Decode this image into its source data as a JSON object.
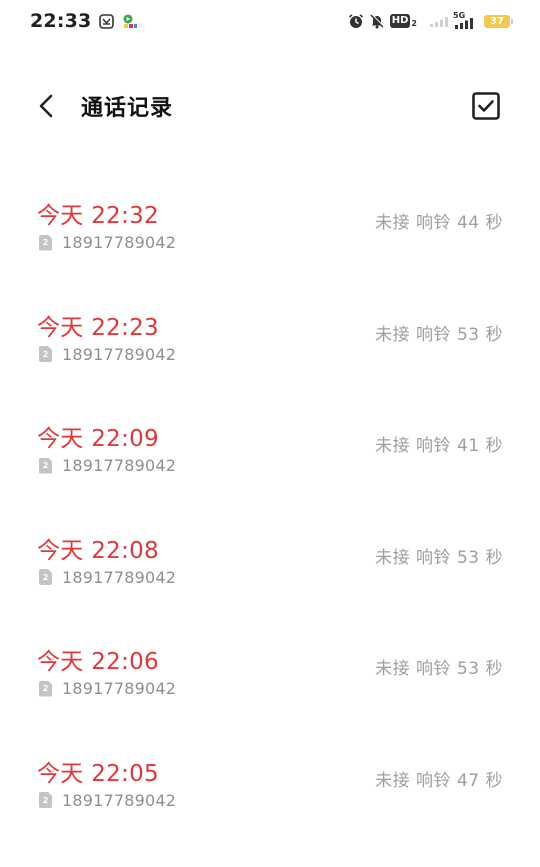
{
  "status_bar": {
    "time": "22:33",
    "icons": [
      "notification-app-icon",
      "game-app-icon",
      "alarm-icon",
      "mute-icon",
      "hd-icon",
      "signal-weak-icon",
      "signal-5g-icon"
    ],
    "network": "5G",
    "hd_label": "HD",
    "hd_sub": "2",
    "battery": "37",
    "battery_color": "#f2c94c"
  },
  "header": {
    "title": "通话记录",
    "back_icon": "chevron-left-icon",
    "select_icon": "checkbox-checked-icon"
  },
  "colors": {
    "missed": "#e0373d",
    "secondary": "#9e9e9e",
    "sim": "#c4c4c4"
  },
  "calls": [
    {
      "time": "今天 22:32",
      "sim": "2",
      "number": "18917789042",
      "status": "未接  响铃 44 秒"
    },
    {
      "time": "今天 22:23",
      "sim": "2",
      "number": "18917789042",
      "status": "未接  响铃 53 秒"
    },
    {
      "time": "今天 22:09",
      "sim": "2",
      "number": "18917789042",
      "status": "未接  响铃 41 秒"
    },
    {
      "time": "今天 22:08",
      "sim": "2",
      "number": "18917789042",
      "status": "未接  响铃 53 秒"
    },
    {
      "time": "今天 22:06",
      "sim": "2",
      "number": "18917789042",
      "status": "未接  响铃 53 秒"
    },
    {
      "time": "今天 22:05",
      "sim": "2",
      "number": "18917789042",
      "status": "未接  响铃 47 秒"
    }
  ]
}
